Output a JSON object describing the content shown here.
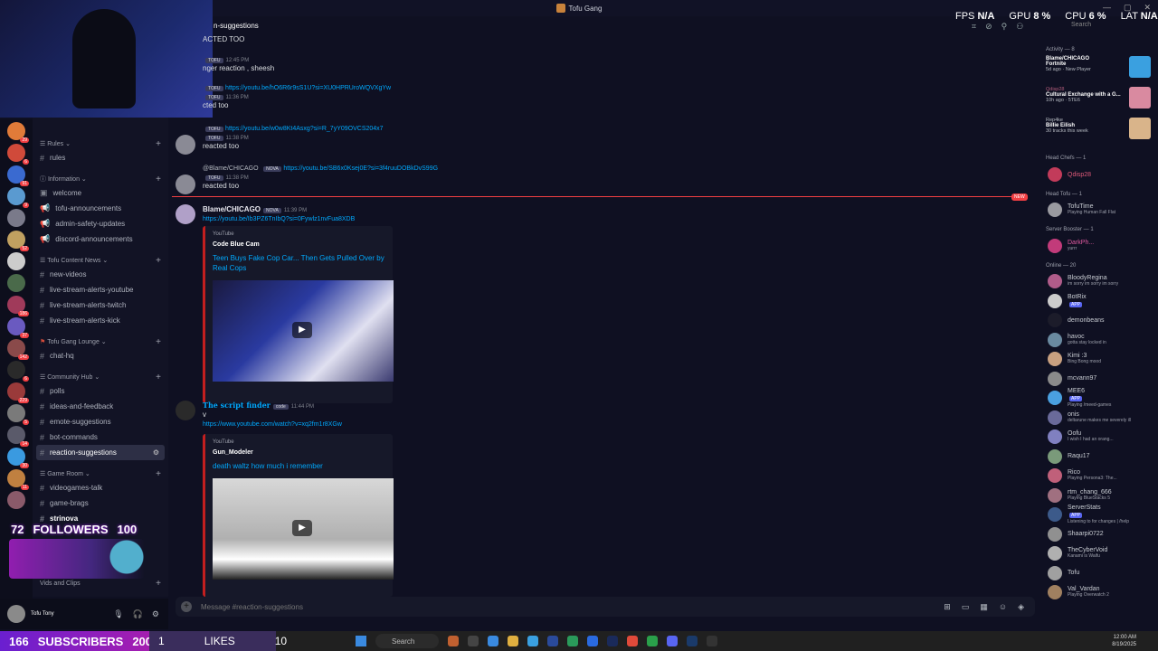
{
  "window": {
    "title": "Tofu Gang",
    "perf": [
      {
        "k": "FPS",
        "v": "N/A"
      },
      {
        "k": "GPU",
        "v": "8 %"
      },
      {
        "k": "CPU",
        "v": "6 %"
      },
      {
        "k": "LAT",
        "v": "N/A"
      }
    ],
    "search": "Search"
  },
  "channel_header": "n-suggestions",
  "sidebar": {
    "categories": [
      {
        "label": "Rules",
        "channels": [
          "rules"
        ]
      },
      {
        "label": "Information",
        "channels": [
          "welcome",
          "tofu-announcements",
          "admin-safety-updates",
          "discord-announcements"
        ]
      },
      {
        "label": "Tofu Content News",
        "channels": [
          "new-videos",
          "live-stream-alerts-youtube",
          "live-stream-alerts-twitch",
          "live-stream-alerts-kick"
        ]
      },
      {
        "label": "Tofu Gang Lounge",
        "channels": [
          "chat-hq"
        ]
      },
      {
        "label": "Community Hub",
        "channels": [
          "polls",
          "ideas-and-feedback",
          "emote-suggestions",
          "bot-commands",
          "reaction-suggestions"
        ]
      },
      {
        "label": "Game Room",
        "channels": [
          "videogames-talk",
          "game-brags",
          "strinova"
        ]
      }
    ],
    "extra_category": "Vids and Clips"
  },
  "messages": {
    "m0": {
      "text": "ACTED TOO"
    },
    "m1": {
      "time": "12:45 PM",
      "text": "nger reaction , sheesh"
    },
    "m2": {
      "link": "https://youtu.be/hO6R6r9sS1U?si=XU0HPRUroWQVXgYw",
      "time": "11:36 PM",
      "text": "cted too"
    },
    "m3": {
      "link": "https://youtu.be/w0w8Kt4Asxg?si=R_7yY09OVCS204x7",
      "time": "11:38 PM",
      "text": "reacted too"
    },
    "m4": {
      "reply": "@Blame/CHICAGO",
      "link": "https://youtu.be/SB6x0Ksej0E?si=3f4ruuDOBkDvS99G",
      "time": "11:38 PM",
      "text": "reacted too"
    },
    "m5": {
      "user": "Blame/CHICAGO",
      "tag": "NOVA",
      "time": "11:39 PM",
      "link": "https://youtu.be/Ib3PZ6TnIbQ?si=0Fywlz1nvFua8XDB",
      "embed": {
        "provider": "YouTube",
        "author": "Code Blue Cam",
        "title": "Teen Buys Fake Cop Car... Then Gets Pulled Over by Real Cops"
      }
    },
    "m6": {
      "user": "The script finder",
      "tag": "code",
      "time": "11:44 PM",
      "text": "v",
      "link": "https://www.youtube.com/watch?v=xq2fm1r8XGw",
      "embed": {
        "provider": "YouTube",
        "author": "Gun_Modeler",
        "title": "death waltz how much i remember"
      }
    }
  },
  "new_badge": "NEW",
  "input_placeholder": "Message #reaction-suggestions",
  "members": {
    "activity_header": "Activity — 8",
    "activities": [
      {
        "name": "Blame/CHICAGO",
        "sub": "Fortnite",
        "sub2": "5d ago · New Player",
        "color": "#3aa0e0"
      },
      {
        "name": "Qdisp28",
        "sub": "Cultural Exchange with a G...",
        "sub2": "10h ago · 5TE6",
        "color": "#d98aa0"
      },
      {
        "name": "Rep4ke",
        "sub": "Billie Eilish",
        "sub2": "30 tracks this week",
        "color": "#d9b48a"
      }
    ],
    "groups": [
      {
        "header": "Head Chefs — 1",
        "items": [
          {
            "nm": "Qdisp28",
            "sub": "",
            "color": "#c23b5a"
          }
        ]
      },
      {
        "header": "Head Tofu — 1",
        "items": [
          {
            "nm": "TofuTime",
            "sub": "Playing Human Fall Flat",
            "color": "#9a9aa0"
          }
        ]
      },
      {
        "header": "Server Booster — 1",
        "items": [
          {
            "nm": "DarkPh...",
            "sub": "yurrr",
            "color": "#c23b7a"
          }
        ]
      },
      {
        "header": "Online — 20",
        "items": [
          {
            "nm": "BloodyRegina",
            "sub": "im sorry im sorry im sorry",
            "color": "#b05c8a"
          },
          {
            "nm": "BotRix",
            "sub": "",
            "color": "#cccccc",
            "app": "APP"
          },
          {
            "nm": "demonbeans",
            "sub": "",
            "color": "#1c1c2a"
          },
          {
            "nm": "havoc",
            "sub": "gotta stay locked in",
            "color": "#6a8aa0"
          },
          {
            "nm": "Kimi :3",
            "sub": "Bing Bong mood",
            "color": "#c8a080"
          },
          {
            "nm": "mcvann97",
            "sub": "",
            "color": "#8a8a8a"
          },
          {
            "nm": "MEE6",
            "sub": "Playing /meed-games",
            "color": "#4aa0e0",
            "app": "APP"
          },
          {
            "nm": "onis",
            "sub": "deltarune makes me severely ill",
            "color": "#6a6a9a"
          },
          {
            "nm": "Oofu",
            "sub": "I wish I had an orang...",
            "color": "#8080c0"
          },
          {
            "nm": "Raqu17",
            "sub": "",
            "color": "#7a9a7a"
          },
          {
            "nm": "Rico",
            "sub": "Playing Persona3: The...",
            "color": "#c0607a"
          },
          {
            "nm": "rtm_chang_666",
            "sub": "Playing BlueStacks 5",
            "color": "#a07080"
          },
          {
            "nm": "ServerStats",
            "sub": "Listening to for changes | /help",
            "color": "#3c5a8a",
            "app": "APP"
          },
          {
            "nm": "Shaarpi0722",
            "sub": "",
            "color": "#909090"
          },
          {
            "nm": "TheCyberVoid",
            "sub": "Kanami is Waifu",
            "color": "#b0b0b0"
          },
          {
            "nm": "Tofu",
            "sub": "",
            "color": "#a0a0a0"
          },
          {
            "nm": "Val_Vardan",
            "sub": "Playing Overwatch 2",
            "color": "#a08060"
          }
        ]
      }
    ]
  },
  "stream": {
    "followers": {
      "count": "72",
      "label": "FOLLOWERS",
      "goal": "100"
    },
    "subscribers": {
      "count": "166",
      "label": "SUBSCRIBERS",
      "goal": "200"
    },
    "likes": {
      "count": "1",
      "label": "LIKES",
      "goal": "10"
    }
  },
  "user_panel": {
    "name": "Tofu Tony"
  },
  "taskbar": {
    "search": "Search",
    "time": "12:00 AM",
    "date": "8/19/2025"
  },
  "colors": {
    "accent": "#5865f2",
    "link": "#00a8fc",
    "new_line": "#f23f43"
  }
}
